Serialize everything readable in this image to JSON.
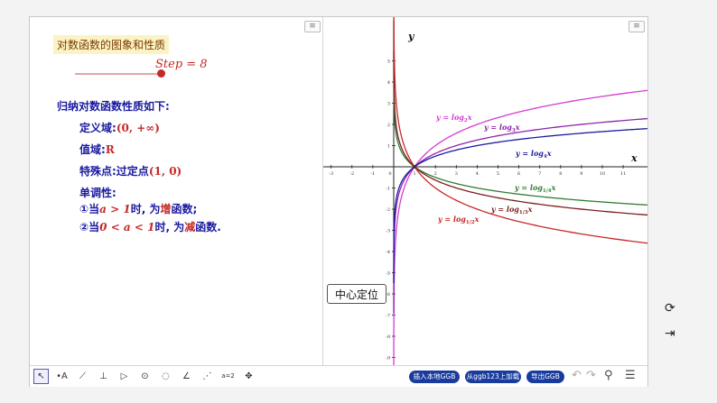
{
  "algebra": {
    "title": "对数函数的图象和性质",
    "slider_label": "Step = 8",
    "heading": "归纳对数函数性质如下:",
    "domain_label": "定义域:",
    "domain_value": "(0, +∞)",
    "range_label": "值域:",
    "range_value": "R",
    "point_label": "特殊点:过定点",
    "point_value": "(1, 0)",
    "monotonic_label": "单调性:",
    "case1_prefix": "①当",
    "case1_cond": "a > 1",
    "case1_mid": "时, 为",
    "case1_word": "增",
    "case1_suffix": "函数;",
    "case2_prefix": "②当",
    "case2_cond": "0 < a < 1",
    "case2_mid": "时, 为",
    "case2_word": "减",
    "case2_suffix": "函数."
  },
  "graphics": {
    "center_button": "中心定位",
    "x_axis_label": "x",
    "y_axis_label": "y",
    "x_ticks": [
      "-3",
      "-2",
      "-1",
      "0",
      "1",
      "2",
      "3",
      "4",
      "5",
      "6",
      "7",
      "8",
      "9",
      "10",
      "11"
    ],
    "y_ticks": [
      "5",
      "4",
      "3",
      "2",
      "1",
      "-1",
      "-2",
      "-3",
      "-4",
      "-5",
      "-6",
      "-7",
      "-8",
      "-9"
    ],
    "curves": [
      {
        "name": "log2",
        "base": 2,
        "label_prefix": "y = log",
        "label_sub": "2",
        "label_suffix": "x",
        "color": "#d63ad6"
      },
      {
        "name": "log3",
        "base": 3,
        "label_prefix": "y = log",
        "label_sub": "3",
        "label_suffix": "x",
        "color": "#8e24aa"
      },
      {
        "name": "log4",
        "base": 4,
        "label_prefix": "y = log",
        "label_sub": "4",
        "label_suffix": "x",
        "color": "#1a1aa0"
      },
      {
        "name": "log1_4",
        "base": 0.25,
        "label_prefix": "y = log",
        "label_sub": "1/4",
        "label_suffix": "x",
        "color": "#2e7d32"
      },
      {
        "name": "log1_3",
        "base": 0.3333,
        "label_prefix": "y = log",
        "label_sub": "1/3",
        "label_suffix": "x",
        "color": "#7b1e1e"
      },
      {
        "name": "log1_2",
        "base": 0.5,
        "label_prefix": "y = log",
        "label_sub": "1/2",
        "label_suffix": "x",
        "color": "#c62828"
      }
    ]
  },
  "toolbar": {
    "tools": [
      "move-tool",
      "point-tool",
      "line-tool",
      "perpendicular-tool",
      "polygon-tool",
      "circle-tool",
      "conic-tool",
      "angle-tool",
      "reflect-tool",
      "slider-tool",
      "move-view-tool"
    ],
    "tool_glyphs": [
      "↖",
      "•A",
      "⟋",
      "⊥",
      "▷",
      "⊙",
      "◌",
      "∠",
      "⋰",
      "a=2",
      "✥"
    ],
    "btn_local": "插入本地GGB",
    "btn_ggb123": "从ggb123上加载",
    "btn_export": "导出GGB"
  },
  "sidebar": {
    "refresh_glyph": "⟳",
    "collapse_glyph": "⇥"
  }
}
